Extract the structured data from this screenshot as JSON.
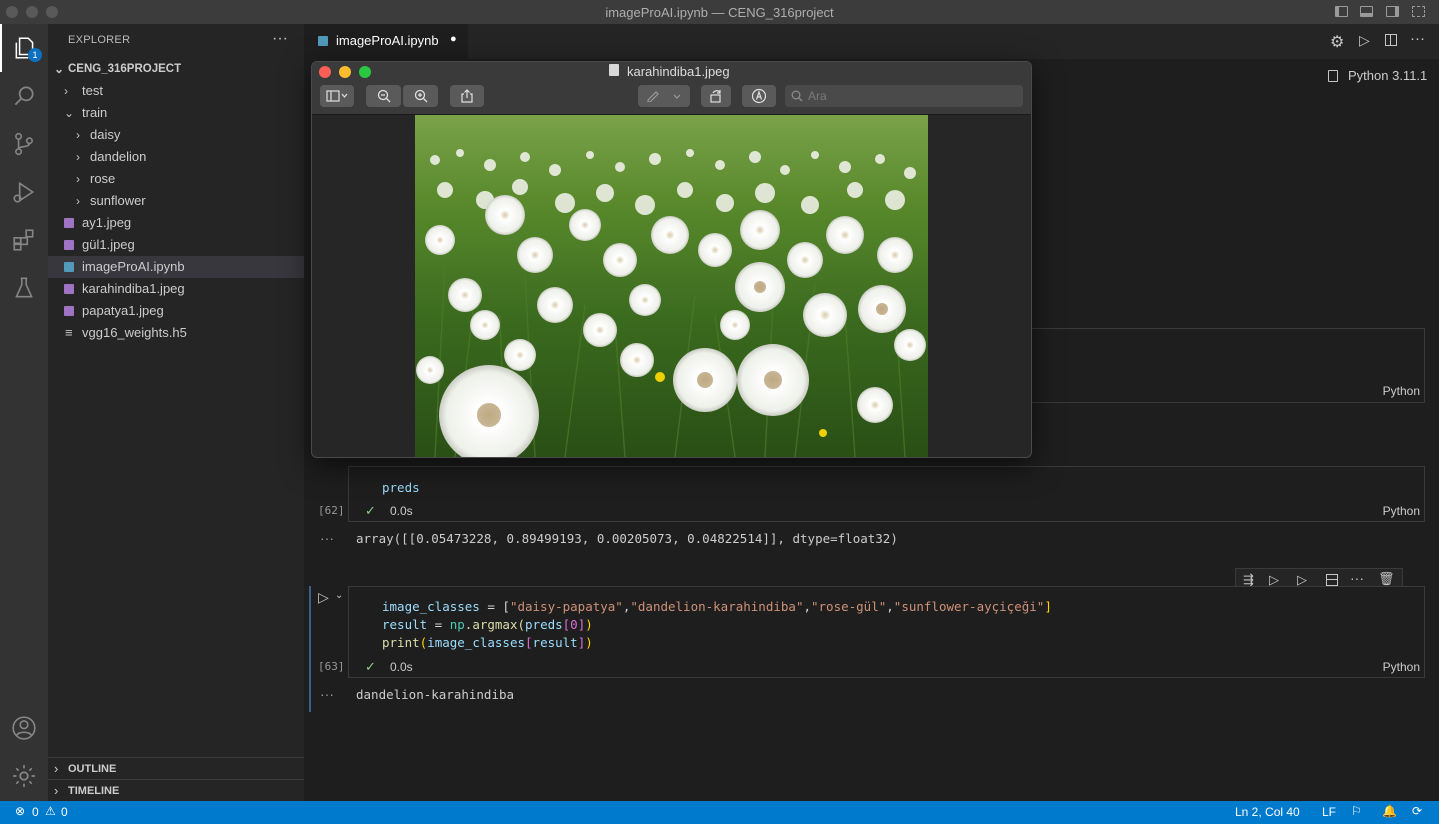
{
  "window": {
    "title": "imageProAI.ipynb — CENG_316project"
  },
  "activity_bar": {
    "explorer_badge": "1"
  },
  "sidebar": {
    "header": "EXPLORER",
    "more": "···",
    "project": "CENG_316PROJECT",
    "items": [
      {
        "label": "test",
        "type": "folder",
        "expanded": false
      },
      {
        "label": "train",
        "type": "folder",
        "expanded": true
      },
      {
        "label": "daisy",
        "type": "folder",
        "expanded": false
      },
      {
        "label": "dandelion",
        "type": "folder",
        "expanded": false
      },
      {
        "label": "rose",
        "type": "folder",
        "expanded": false
      },
      {
        "label": "sunflower",
        "type": "folder",
        "expanded": false
      },
      {
        "label": "ay1.jpeg",
        "type": "image"
      },
      {
        "label": "gül1.jpeg",
        "type": "image"
      },
      {
        "label": "imageProAI.ipynb",
        "type": "notebook",
        "selected": true
      },
      {
        "label": "karahindiba1.jpeg",
        "type": "image"
      },
      {
        "label": "papatya1.jpeg",
        "type": "image"
      },
      {
        "label": "vgg16_weights.h5",
        "type": "file"
      }
    ],
    "outline": "OUTLINE",
    "timeline": "TIMELINE"
  },
  "editor": {
    "tab_label": "imageProAI.ipynb",
    "tab_modified": "●",
    "kernel": "Python 3.11.1",
    "cells": {
      "partial_lang": "Python",
      "cell62": {
        "code": "preds",
        "exec_count": "[62]",
        "time": "0.0s",
        "lang": "Python",
        "output": "array([[0.05473228, 0.89499193, 0.00205073, 0.04822514]], dtype=float32)"
      },
      "cell63": {
        "line1_var": "image_classes",
        "line1_eq": " = [",
        "s1": "\"daisy-papatya\"",
        "s2": "\"dandelion-karahindiba\"",
        "s3": "\"rose-gül\"",
        "s4": "\"sunflower-ayçiçeği\"",
        "line2_var": "result",
        "line2_eq": " = ",
        "line2_np": "np",
        "line2_fn": ".argmax(",
        "line2_arg": "preds",
        "line2_idx": "[0]",
        "line2_end": ")",
        "line3_fn": "print",
        "line3_open": "(",
        "line3_var": "image_classes",
        "line3_idx_open": "[",
        "line3_idx": "result",
        "line3_idx_close": "]",
        "line3_close": ")",
        "exec_count": "[63]",
        "time": "0.0s",
        "lang": "Python",
        "output": "dandelion-karahindiba"
      }
    },
    "output_ellipsis": "···"
  },
  "preview": {
    "title": "karahindiba1.jpeg",
    "search_placeholder": "Ara"
  },
  "statusbar": {
    "errors": "0",
    "warnings": "0",
    "position": "Ln 2, Col 40",
    "eol": "LF"
  },
  "colors": {
    "accent": "#007acc",
    "string": "#ce9178",
    "variable": "#9cdcfe",
    "function": "#dcdcaa",
    "module": "#4ec9b0",
    "bracket": "#ffd700",
    "success": "#89d185"
  }
}
